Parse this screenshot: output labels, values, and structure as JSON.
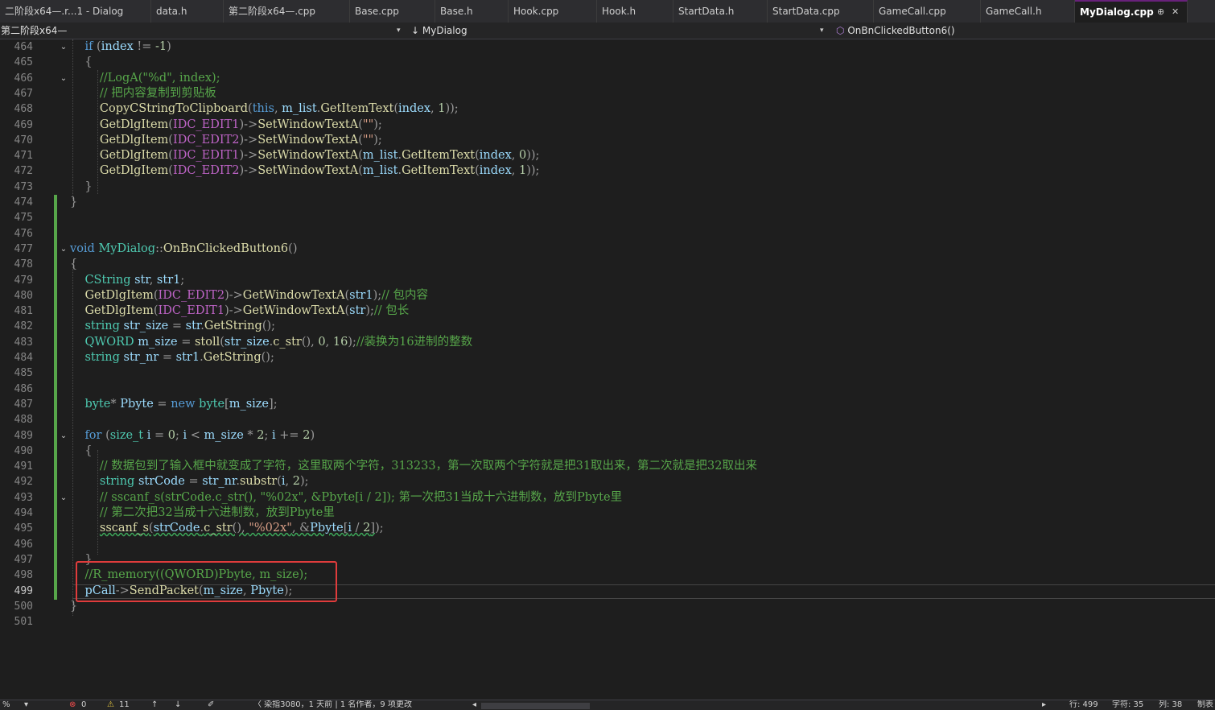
{
  "tabs": [
    {
      "label": "二阶段x64—.r...1 - Dialog",
      "active": false
    },
    {
      "label": "data.h",
      "active": false
    },
    {
      "label": "第二阶段x64—.cpp",
      "active": false
    },
    {
      "label": "Base.cpp",
      "active": false
    },
    {
      "label": "Base.h",
      "active": false
    },
    {
      "label": "Hook.cpp",
      "active": false
    },
    {
      "label": "Hook.h",
      "active": false
    },
    {
      "label": "StartData.h",
      "active": false
    },
    {
      "label": "StartData.cpp",
      "active": false
    },
    {
      "label": "GameCall.cpp",
      "active": false
    },
    {
      "label": "GameCall.h",
      "active": false
    },
    {
      "label": "MyDialog.cpp",
      "active": true
    }
  ],
  "tab_icons": {
    "pin": "⊕",
    "close": "✕"
  },
  "navbar": {
    "project": "第二阶段x64—",
    "class_icon": "↓",
    "class_name": "MyDialog",
    "method_icon": "⬡",
    "method_name": "OnBnClickedButton6()",
    "dropdown_icon": "▾"
  },
  "editor": {
    "current_line": "499",
    "lines": [
      {
        "n": "464",
        "code": [
          [
            "    ",
            ""
          ],
          [
            "if",
            "kw"
          ],
          [
            " (",
            "pm"
          ],
          [
            "index",
            "var"
          ],
          [
            " != ",
            "pm"
          ],
          [
            "-1",
            "num"
          ],
          [
            ")",
            "pm"
          ]
        ]
      },
      {
        "n": "465",
        "code": [
          [
            "    {",
            "pm"
          ]
        ]
      },
      {
        "n": "466",
        "code": [
          [
            "        ",
            ""
          ],
          [
            "//LogA(\"%d\", index);",
            "cm"
          ]
        ]
      },
      {
        "n": "467",
        "code": [
          [
            "        ",
            ""
          ],
          [
            "// 把内容复制到剪贴板",
            "cm"
          ]
        ]
      },
      {
        "n": "468",
        "code": [
          [
            "        ",
            ""
          ],
          [
            "CopyCStringToClipboard",
            "fn"
          ],
          [
            "(",
            "pm"
          ],
          [
            "this",
            "kw"
          ],
          [
            ", ",
            "pm"
          ],
          [
            "m_list",
            "var"
          ],
          [
            ".",
            "pm"
          ],
          [
            "GetItemText",
            "fn"
          ],
          [
            "(",
            "pm"
          ],
          [
            "index",
            "var"
          ],
          [
            ", ",
            "pm"
          ],
          [
            "1",
            "num"
          ],
          [
            "));",
            "pm"
          ]
        ]
      },
      {
        "n": "469",
        "code": [
          [
            "        ",
            ""
          ],
          [
            "GetDlgItem",
            "fn"
          ],
          [
            "(",
            "pm"
          ],
          [
            "IDC_EDIT1",
            "mac"
          ],
          [
            ")->",
            "pm"
          ],
          [
            "SetWindowTextA",
            "fn"
          ],
          [
            "(",
            "pm"
          ],
          [
            "\"\"",
            "str"
          ],
          [
            ");",
            "pm"
          ]
        ]
      },
      {
        "n": "470",
        "code": [
          [
            "        ",
            ""
          ],
          [
            "GetDlgItem",
            "fn"
          ],
          [
            "(",
            "pm"
          ],
          [
            "IDC_EDIT2",
            "mac"
          ],
          [
            ")->",
            "pm"
          ],
          [
            "SetWindowTextA",
            "fn"
          ],
          [
            "(",
            "pm"
          ],
          [
            "\"\"",
            "str"
          ],
          [
            ");",
            "pm"
          ]
        ]
      },
      {
        "n": "471",
        "code": [
          [
            "        ",
            ""
          ],
          [
            "GetDlgItem",
            "fn"
          ],
          [
            "(",
            "pm"
          ],
          [
            "IDC_EDIT1",
            "mac"
          ],
          [
            ")->",
            "pm"
          ],
          [
            "SetWindowTextA",
            "fn"
          ],
          [
            "(",
            "pm"
          ],
          [
            "m_list",
            "var"
          ],
          [
            ".",
            "pm"
          ],
          [
            "GetItemText",
            "fn"
          ],
          [
            "(",
            "pm"
          ],
          [
            "index",
            "var"
          ],
          [
            ", ",
            "pm"
          ],
          [
            "0",
            "num"
          ],
          [
            "));",
            "pm"
          ]
        ]
      },
      {
        "n": "472",
        "code": [
          [
            "        ",
            ""
          ],
          [
            "GetDlgItem",
            "fn"
          ],
          [
            "(",
            "pm"
          ],
          [
            "IDC_EDIT2",
            "mac"
          ],
          [
            ")->",
            "pm"
          ],
          [
            "SetWindowTextA",
            "fn"
          ],
          [
            "(",
            "pm"
          ],
          [
            "m_list",
            "var"
          ],
          [
            ".",
            "pm"
          ],
          [
            "GetItemText",
            "fn"
          ],
          [
            "(",
            "pm"
          ],
          [
            "index",
            "var"
          ],
          [
            ", ",
            "pm"
          ],
          [
            "1",
            "num"
          ],
          [
            "));",
            "pm"
          ]
        ]
      },
      {
        "n": "473",
        "code": [
          [
            "    }",
            "pm"
          ]
        ]
      },
      {
        "n": "474",
        "code": [
          [
            "}",
            "pm"
          ]
        ]
      },
      {
        "n": "475",
        "code": []
      },
      {
        "n": "476",
        "code": []
      },
      {
        "n": "477",
        "code": [
          [
            "void",
            "kw"
          ],
          [
            " ",
            ""
          ],
          [
            "MyDialog",
            "ty"
          ],
          [
            "::",
            "pm"
          ],
          [
            "OnBnClickedButton6",
            "fn"
          ],
          [
            "()",
            "pm"
          ]
        ]
      },
      {
        "n": "478",
        "code": [
          [
            "{",
            "pm"
          ]
        ]
      },
      {
        "n": "479",
        "code": [
          [
            "    ",
            ""
          ],
          [
            "CString",
            "ty"
          ],
          [
            " ",
            ""
          ],
          [
            "str",
            "var"
          ],
          [
            ", ",
            "pm"
          ],
          [
            "str1",
            "var"
          ],
          [
            ";",
            "pm"
          ]
        ]
      },
      {
        "n": "480",
        "code": [
          [
            "    ",
            ""
          ],
          [
            "GetDlgItem",
            "fn"
          ],
          [
            "(",
            "pm"
          ],
          [
            "IDC_EDIT2",
            "mac"
          ],
          [
            ")->",
            "pm"
          ],
          [
            "GetWindowTextA",
            "fn"
          ],
          [
            "(",
            "pm"
          ],
          [
            "str1",
            "var"
          ],
          [
            ");",
            "pm"
          ],
          [
            "// 包内容",
            "cm"
          ]
        ]
      },
      {
        "n": "481",
        "code": [
          [
            "    ",
            ""
          ],
          [
            "GetDlgItem",
            "fn"
          ],
          [
            "(",
            "pm"
          ],
          [
            "IDC_EDIT1",
            "mac"
          ],
          [
            ")->",
            "pm"
          ],
          [
            "GetWindowTextA",
            "fn"
          ],
          [
            "(",
            "pm"
          ],
          [
            "str",
            "var"
          ],
          [
            ");",
            "pm"
          ],
          [
            "// 包长",
            "cm"
          ]
        ]
      },
      {
        "n": "482",
        "code": [
          [
            "    ",
            ""
          ],
          [
            "string",
            "ty"
          ],
          [
            " ",
            ""
          ],
          [
            "str_size",
            "var"
          ],
          [
            " = ",
            "pm"
          ],
          [
            "str",
            "var"
          ],
          [
            ".",
            "pm"
          ],
          [
            "GetString",
            "fn"
          ],
          [
            "();",
            "pm"
          ]
        ]
      },
      {
        "n": "483",
        "code": [
          [
            "    ",
            ""
          ],
          [
            "QWORD",
            "ty"
          ],
          [
            " ",
            ""
          ],
          [
            "m_size",
            "var"
          ],
          [
            " = ",
            "pm"
          ],
          [
            "stoll",
            "fn"
          ],
          [
            "(",
            "pm"
          ],
          [
            "str_size",
            "var"
          ],
          [
            ".",
            "pm"
          ],
          [
            "c_str",
            "fn"
          ],
          [
            "(), ",
            "pm"
          ],
          [
            "0",
            "num"
          ],
          [
            ", ",
            "pm"
          ],
          [
            "16",
            "num"
          ],
          [
            ");",
            "pm"
          ],
          [
            "//装换为16进制的整数",
            "cm"
          ]
        ]
      },
      {
        "n": "484",
        "code": [
          [
            "    ",
            ""
          ],
          [
            "string",
            "ty"
          ],
          [
            " ",
            ""
          ],
          [
            "str_nr",
            "var"
          ],
          [
            " = ",
            "pm"
          ],
          [
            "str1",
            "var"
          ],
          [
            ".",
            "pm"
          ],
          [
            "GetString",
            "fn"
          ],
          [
            "();",
            "pm"
          ]
        ]
      },
      {
        "n": "485",
        "code": []
      },
      {
        "n": "486",
        "code": []
      },
      {
        "n": "487",
        "code": [
          [
            "    ",
            ""
          ],
          [
            "byte",
            "ty"
          ],
          [
            "* ",
            "pm"
          ],
          [
            "Pbyte",
            "var"
          ],
          [
            " = ",
            "pm"
          ],
          [
            "new",
            "kw"
          ],
          [
            " ",
            ""
          ],
          [
            "byte",
            "ty"
          ],
          [
            "[",
            "pm"
          ],
          [
            "m_size",
            "var"
          ],
          [
            "];",
            "pm"
          ]
        ]
      },
      {
        "n": "488",
        "code": []
      },
      {
        "n": "489",
        "code": [
          [
            "    ",
            ""
          ],
          [
            "for",
            "kw"
          ],
          [
            " (",
            "pm"
          ],
          [
            "size_t",
            "ty"
          ],
          [
            " ",
            ""
          ],
          [
            "i",
            "var"
          ],
          [
            " = ",
            "pm"
          ],
          [
            "0",
            "num"
          ],
          [
            "; ",
            "pm"
          ],
          [
            "i",
            "var"
          ],
          [
            " < ",
            "pm"
          ],
          [
            "m_size",
            "var"
          ],
          [
            " * ",
            "pm"
          ],
          [
            "2",
            "num"
          ],
          [
            "; ",
            "pm"
          ],
          [
            "i",
            "var"
          ],
          [
            " += ",
            "pm"
          ],
          [
            "2",
            "num"
          ],
          [
            ")",
            "pm"
          ]
        ]
      },
      {
        "n": "490",
        "code": [
          [
            "    {",
            "pm"
          ]
        ]
      },
      {
        "n": "491",
        "code": [
          [
            "        ",
            ""
          ],
          [
            "// 数据包到了输入框中就变成了字符，这里取两个字符，313233，第一次取两个字符就是把31取出来，第二次就是把32取出来",
            "cm"
          ]
        ]
      },
      {
        "n": "492",
        "code": [
          [
            "        ",
            ""
          ],
          [
            "string",
            "ty"
          ],
          [
            " ",
            ""
          ],
          [
            "strCode",
            "var"
          ],
          [
            " = ",
            "pm"
          ],
          [
            "str_nr",
            "var"
          ],
          [
            ".",
            "pm"
          ],
          [
            "substr",
            "fn"
          ],
          [
            "(",
            "pm"
          ],
          [
            "i",
            "var"
          ],
          [
            ", ",
            "pm"
          ],
          [
            "2",
            "num"
          ],
          [
            ");",
            "pm"
          ]
        ]
      },
      {
        "n": "493",
        "code": [
          [
            "        ",
            ""
          ],
          [
            "// sscanf_s(strCode.c_str(), \"%02x\", &Pbyte[i / 2]); 第一次把31当成十六进制数，放到Pbyte里",
            "cm"
          ]
        ]
      },
      {
        "n": "494",
        "code": [
          [
            "        ",
            ""
          ],
          [
            "// 第二次把32当成十六进制数，放到Pbyte里",
            "cm"
          ]
        ]
      },
      {
        "n": "495",
        "code": [
          [
            "        ",
            ""
          ],
          [
            "sscanf_s",
            "fn sq"
          ],
          [
            "(",
            "pm sq"
          ],
          [
            "strCode",
            "var sq"
          ],
          [
            ".",
            "pm sq"
          ],
          [
            "c_str",
            "fn sq"
          ],
          [
            "(), ",
            "pm sq"
          ],
          [
            "\"%02x\"",
            "str sq"
          ],
          [
            ", &",
            "pm sq"
          ],
          [
            "Pbyte",
            "var sq"
          ],
          [
            "[",
            "pm sq"
          ],
          [
            "i",
            "var sq"
          ],
          [
            " / ",
            "pm sq"
          ],
          [
            "2",
            "num sq"
          ],
          [
            "]",
            "pm sq"
          ],
          [
            ");",
            "pm"
          ]
        ]
      },
      {
        "n": "496",
        "code": []
      },
      {
        "n": "497",
        "code": [
          [
            "    }",
            "pm"
          ]
        ]
      },
      {
        "n": "498",
        "code": [
          [
            "    ",
            ""
          ],
          [
            "//R_memory((QWORD)Pbyte, m_size);",
            "cm"
          ]
        ]
      },
      {
        "n": "499",
        "code": [
          [
            "    ",
            ""
          ],
          [
            "pCall",
            "var"
          ],
          [
            "->",
            "pm"
          ],
          [
            "SendPacket",
            "fn"
          ],
          [
            "(",
            "pm"
          ],
          [
            "m_size",
            "var"
          ],
          [
            ", ",
            "pm"
          ],
          [
            "Pbyte",
            "var"
          ],
          [
            ");",
            "pm"
          ]
        ]
      },
      {
        "n": "500",
        "code": [
          [
            "}",
            "pm"
          ]
        ]
      },
      {
        "n": "501",
        "code": []
      }
    ]
  },
  "statusbar": {
    "zoom": "%",
    "errors_icon": "⊗",
    "errors": "0",
    "warnings_icon": "⚠",
    "warnings": "11",
    "up_arrow": "↑",
    "down_arrow": "↓",
    "brush_icon": "✐",
    "git_info": "〈 染指3080，1 天前 | 1 名作者，9 项更改",
    "scroll_left": "◂",
    "scroll_right": "▸",
    "line": "行: 499",
    "char": "字符: 35",
    "col": "列: 38",
    "indent": "制表"
  }
}
